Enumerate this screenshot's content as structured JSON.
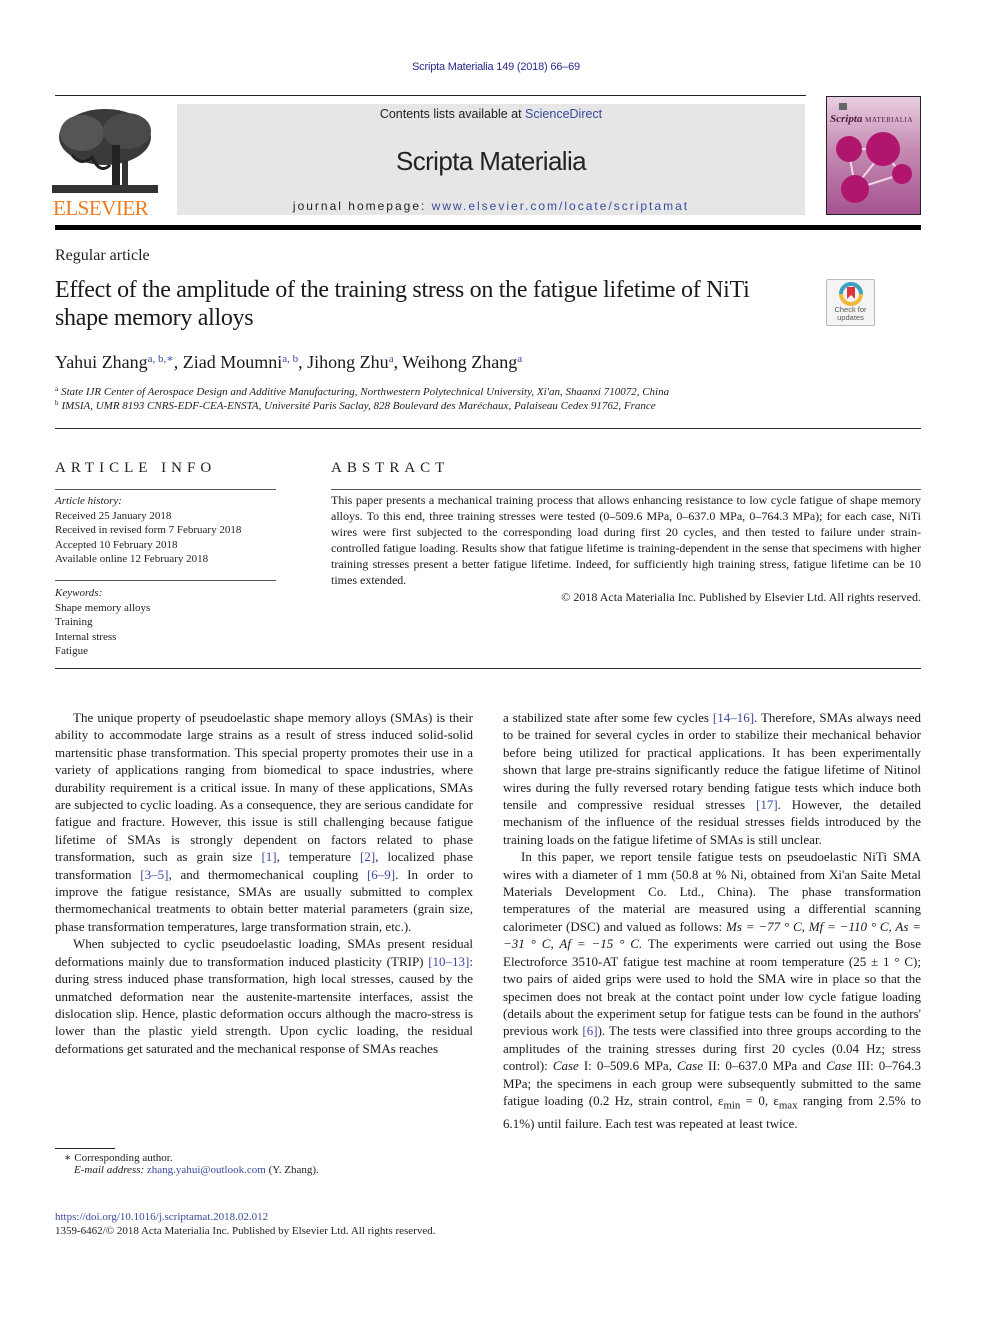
{
  "header": {
    "citation": "Scripta Materialia 149 (2018) 66–69",
    "contents_prefix": "Contents lists available at ",
    "contents_link": "ScienceDirect",
    "journal_title": "Scripta Materialia",
    "homepage_prefix": "journal homepage: ",
    "homepage_url": "www.elsevier.com/locate/scriptamat",
    "publisher_logo_text": "ELSEVIER",
    "cover_title": "Scripta",
    "cover_subtitle": "MATERIALIA",
    "colors": {
      "link": "#3b4a9b",
      "elsevier_orange": "#f07b20",
      "masthead_bg": "#e6e6e6"
    }
  },
  "article": {
    "type": "Regular article",
    "title": "Effect of the amplitude of the training stress on the fatigue lifetime of NiTi shape memory alloys",
    "crossmark_label_1": "Check for",
    "crossmark_label_2": "updates",
    "authors": [
      {
        "name": "Yahui Zhang",
        "sup": "a, b,∗"
      },
      {
        "name": "Ziad Moumni",
        "sup": "a, b"
      },
      {
        "name": "Jihong Zhu",
        "sup": "a"
      },
      {
        "name": "Weihong Zhang",
        "sup": "a"
      }
    ],
    "affiliations": [
      {
        "key": "a",
        "text": "State IJR Center of Aerospace Design and Additive Manufacturing, Northwestern Polytechnical University, Xi'an, Shaanxi 710072, China"
      },
      {
        "key": "b",
        "text": "IMSIA, UMR 8193 CNRS-EDF-CEA-ENSTA, Université Paris Saclay, 828 Boulevard des Maréchaux, Palaiseau Cedex 91762, France"
      }
    ]
  },
  "article_info": {
    "heading": "ARTICLE INFO",
    "history_label": "Article history:",
    "history": [
      "Received 25 January 2018",
      "Received in revised form 7 February 2018",
      "Accepted 10 February 2018",
      "Available online 12 February 2018"
    ],
    "keywords_label": "Keywords:",
    "keywords": [
      "Shape memory alloys",
      "Training",
      "Internal stress",
      "Fatigue"
    ]
  },
  "abstract": {
    "heading": "ABSTRACT",
    "text": "This paper presents a mechanical training process that allows enhancing resistance to low cycle fatigue of shape memory alloys. To this end, three training stresses were tested (0–509.6 MPa, 0–637.0 MPa, 0–764.3 MPa); for each case, NiTi wires were first subjected to the corresponding load during first 20 cycles, and then tested to failure under strain-controlled fatigue loading. Results show that fatigue lifetime is training-dependent in the sense that specimens with higher training stresses present a better fatigue lifetime. Indeed, for sufficiently high training stress, fatigue lifetime can be 10 times extended.",
    "copyright": "© 2018  Acta Materialia Inc. Published by Elsevier Ltd. All rights reserved."
  },
  "body": {
    "p1": {
      "t1": "The unique property of pseudoelastic shape memory alloys (SMAs) is their ability to accommodate large strains as a result of stress induced solid-solid martensitic phase transformation. This special property promotes their use in a variety of applications ranging from biomedical to space industries, where durability requirement is a critical issue. In many of these applications, SMAs are subjected to cyclic loading. As a consequence, they are serious candidate for fatigue and fracture. However, this issue is still challenging because fatigue lifetime of SMAs is strongly dependent on factors related to phase transformation, such as grain size ",
      "r1": "[1]",
      "t2": ", temperature ",
      "r2": "[2]",
      "t3": ", localized phase transformation ",
      "r3": "[3–5]",
      "t4": ", and thermomechanical coupling ",
      "r4": "[6–9]",
      "t5": ". In order to improve the fatigue resistance, SMAs are usually submitted to complex thermomechanical treatments to obtain better material parameters (grain size, phase transformation temperatures, large transformation strain, etc.)."
    },
    "p2": {
      "t1": "When subjected to cyclic pseudoelastic loading, SMAs present residual deformations mainly due to transformation induced plasticity (TRIP) ",
      "r1": "[10–13]",
      "t2": ": during stress induced phase transformation, high local stresses, caused by the unmatched deformation near the austenite-martensite interfaces, assist the dislocation slip. Hence, plastic deformation occurs although the macro-stress is lower than the plastic yield strength. Upon cyclic loading, the residual deformations get saturated and the mechanical response of SMAs reaches a stabilized state after some few cycles ",
      "r2": "[14–16]",
      "t3": ". Therefore, SMAs always need to be trained for several cycles in order to stabilize their mechanical behavior before being utilized for practical applications. It has been experimentally shown that large pre-strains significantly reduce the fatigue lifetime of Nitinol wires during the fully reversed rotary bending fatigue tests which induce both tensile and compressive residual stresses ",
      "r3": "[17]",
      "t4": ". However, the detailed mechanism of the influence of the residual stresses fields introduced by the training loads on the fatigue lifetime of SMAs is still unclear."
    },
    "p3": {
      "t1": "In this paper, we report tensile fatigue tests on pseudoelastic NiTi SMA wires with a diameter of 1 mm (50.8 at % Ni, obtained from Xi'an Saite Metal Materials Development Co. Ltd., China). The phase transformation temperatures of the material are measured using a differential scanning calorimeter (DSC) and valued as follows: ",
      "ms": "Ms = −77 ° C, ",
      "mf": "Mf = −110 ° C, ",
      "as": "As = −31 ° C, ",
      "af": "Af = −15 ° C.",
      "t2": " The experiments were carried out using the Bose Electroforce 3510-AT fatigue test machine at room temperature (25 ± 1 ° C); two pairs of aided grips were used to hold the SMA wire in place so that the specimen does not break at the contact point under low cycle fatigue loading (details about the experiment setup for fatigue tests can be found in the authors' previous work ",
      "r1": "[6]",
      "t3": "). The tests were classified into three groups according to the amplitudes of the training stresses during first 20 cycles (0.04 Hz; stress control): ",
      "case1_label": "Case",
      "case1": " I: 0–509.6 MPa, ",
      "case2_label": "Case",
      "case2": " II: 0–637.0 MPa and ",
      "case3_label": "Case",
      "case3": " III: 0–764.3 MPa; the specimens in each group were subsequently submitted to the same fatigue loading (0.2 Hz, strain control, ε",
      "sub_min": "min",
      "t4": " = 0, ε",
      "sub_max": "max",
      "t5": " ranging from 2.5% to 6.1%) until failure. Each test was repeated at least twice."
    }
  },
  "footnotes": {
    "corresponding": "∗ Corresponding author.",
    "email_label": "E-mail address: ",
    "email": "zhang.yahui@outlook.com",
    "email_suffix": " (Y. Zhang).",
    "doi": "https://doi.org/10.1016/j.scriptamat.2018.02.012",
    "issn": "1359-6462/© 2018  Acta Materialia Inc. Published by Elsevier Ltd. All rights reserved."
  }
}
